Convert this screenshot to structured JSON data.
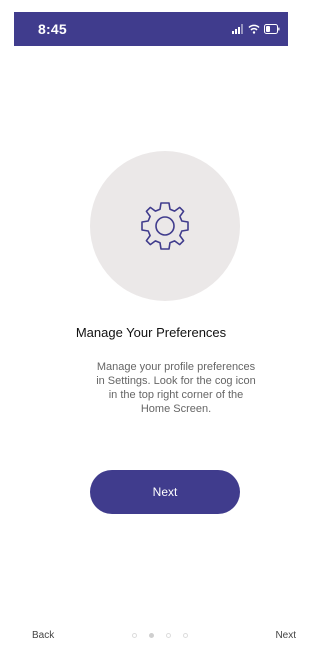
{
  "status_bar": {
    "time": "8:45",
    "icons": [
      "signal-icon",
      "wifi-icon",
      "battery-icon"
    ]
  },
  "onboarding": {
    "illustration_icon": "cog-icon",
    "title": "Manage Your Preferences",
    "description": "Manage your profile preferences in Settings. Look for the cog icon in the top right corner of the Home Screen.",
    "next_button": "Next"
  },
  "footer": {
    "back_label": "Back",
    "next_label": "Next",
    "page_count": 4,
    "active_page": 2
  },
  "colors": {
    "brand": "#403c8d",
    "illustration_bg": "#ebe8e8"
  }
}
